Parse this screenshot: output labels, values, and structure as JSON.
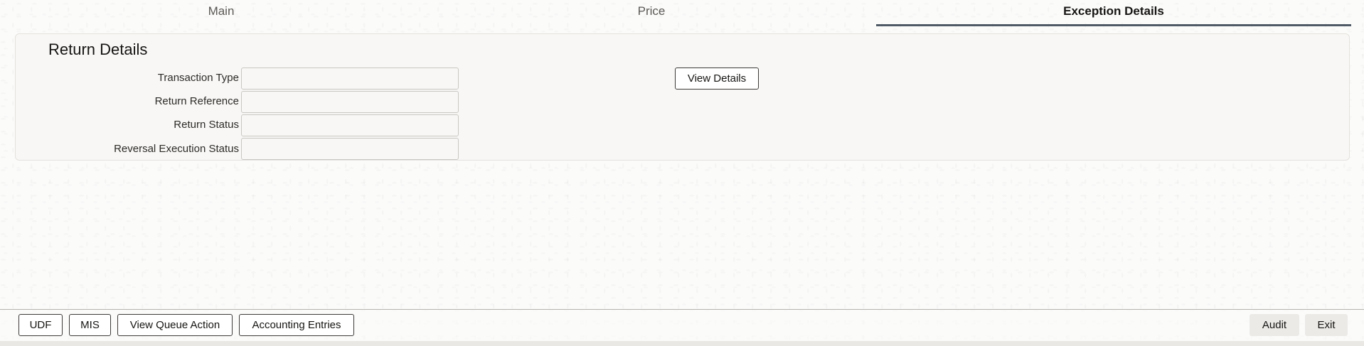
{
  "tabs": {
    "main": "Main",
    "price": "Price",
    "exception_details": "Exception Details"
  },
  "return_details": {
    "title": "Return Details",
    "fields": {
      "transaction_type": {
        "label": "Transaction Type",
        "value": ""
      },
      "return_reference": {
        "label": "Return Reference",
        "value": ""
      },
      "return_status": {
        "label": "Return Status",
        "value": ""
      },
      "reversal_execution_status": {
        "label": "Reversal Execution Status",
        "value": ""
      }
    },
    "view_details_label": "View Details"
  },
  "footer": {
    "udf": "UDF",
    "mis": "MIS",
    "view_queue_action": "View Queue Action",
    "accounting_entries": "Accounting Entries",
    "audit": "Audit",
    "exit": "Exit"
  }
}
